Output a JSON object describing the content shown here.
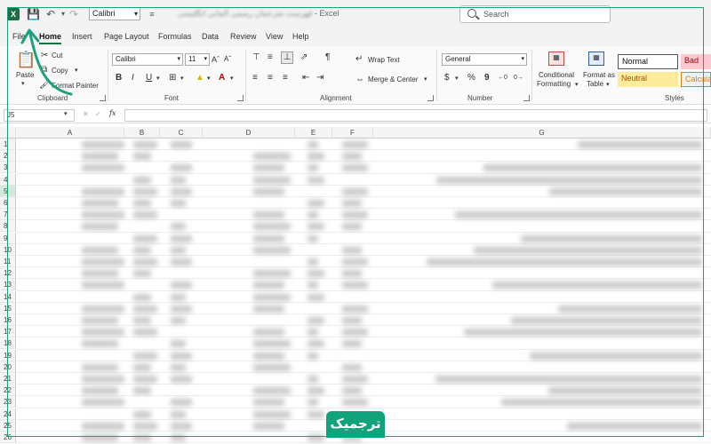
{
  "titlebar": {
    "app_icon_letter": "X",
    "quick_font": "Calibri",
    "title_sep": "-",
    "title_app": "Excel",
    "search_placeholder": "Search"
  },
  "tabs": [
    "File",
    "Home",
    "Insert",
    "Page Layout",
    "Formulas",
    "Data",
    "Review",
    "View",
    "Help"
  ],
  "ribbon": {
    "clipboard": {
      "paste": "Paste",
      "cut": "Cut",
      "copy": "Copy",
      "format_painter": "Format Painter",
      "label": "Clipboard"
    },
    "font": {
      "family": "Calibri",
      "size": "11",
      "bold": "B",
      "italic": "I",
      "underline": "U",
      "label": "Font"
    },
    "alignment": {
      "wrap_text": "Wrap Text",
      "merge_center": "Merge & Center",
      "label": "Alignment"
    },
    "number": {
      "format": "General",
      "currency": "$",
      "percent": "%",
      "comma": "9",
      "label": "Number"
    },
    "styles": {
      "conditional_1": "Conditional",
      "conditional_2": "Formatting",
      "format_as_1": "Format as",
      "format_as_2": "Table",
      "normal": "Normal",
      "bad": "Bad",
      "neutral": "Neutral",
      "calculation": "Calculati",
      "label": "Styles"
    }
  },
  "formula_bar": {
    "name_box": "J5",
    "fx": "fx"
  },
  "grid": {
    "columns": [
      "A",
      "B",
      "C",
      "D",
      "E",
      "F",
      "G"
    ],
    "rows": [
      "1",
      "2",
      "3",
      "4",
      "5",
      "6",
      "7",
      "8",
      "9",
      "10",
      "11",
      "12",
      "13",
      "14",
      "15",
      "16",
      "17",
      "18",
      "19",
      "20",
      "21",
      "22",
      "23",
      "24",
      "25",
      "26"
    ],
    "selected_row": "5"
  },
  "watermark": {
    "text": "ترجمیک"
  },
  "colors": {
    "excel_green": "#1d6f42",
    "frame_green": "#1aa27d",
    "badge_green": "#13a37c"
  }
}
